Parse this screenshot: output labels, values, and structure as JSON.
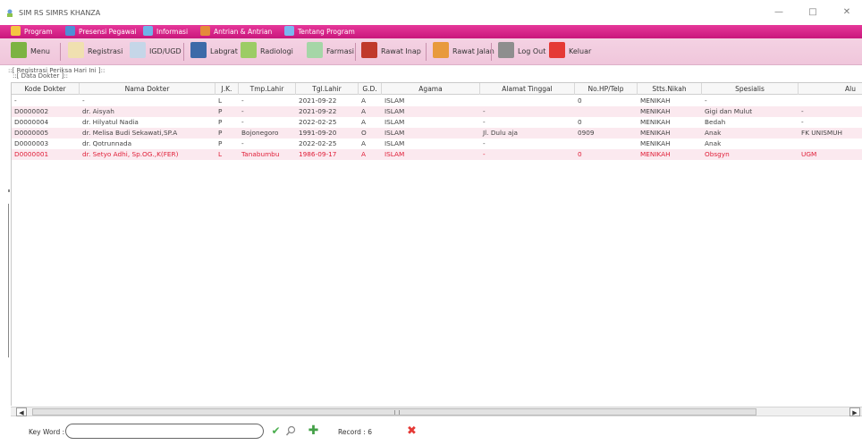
{
  "window": {
    "title": "SIM RS SIMRS KHANZA",
    "controls": {
      "minimize": "—",
      "maximize": "□",
      "close": "✕"
    }
  },
  "menubar": [
    {
      "label": "Program",
      "icon": "key-icon"
    },
    {
      "label": "Presensi Pegawai",
      "icon": "people-icon"
    },
    {
      "label": "Informasi",
      "icon": "info-icon"
    },
    {
      "label": "Antrian & Antrian",
      "icon": "queue-icon"
    },
    {
      "label": "Tentang Program",
      "icon": "about-icon"
    }
  ],
  "toolbar": [
    {
      "label": "Menu",
      "icon": "home-icon"
    },
    {
      "label": "Registrasi",
      "icon": "register-icon"
    },
    {
      "label": "IGD/UGD",
      "icon": "emergency-icon"
    },
    {
      "label": "Labgrat",
      "icon": "lab-icon"
    },
    {
      "label": "Radiologi",
      "icon": "radiology-icon"
    },
    {
      "label": "Farmasi",
      "icon": "pharmacy-icon"
    },
    {
      "label": "Rawat Inap",
      "icon": "inpatient-icon"
    },
    {
      "label": "Rawat Jalan",
      "icon": "outpatient-icon"
    },
    {
      "label": "Log Out",
      "icon": "logout-icon"
    },
    {
      "label": "Keluar",
      "icon": "exit-icon"
    }
  ],
  "panels": {
    "outer_title": "::[ Registrasi Periksa Hari Ini ]::",
    "inner_title": "::[ Data Dokter ]::"
  },
  "table": {
    "columns": [
      "Kode Dokter",
      "Nama Dokter",
      "J.K.",
      "Tmp.Lahir",
      "Tgl.Lahir",
      "G.D.",
      "Agama",
      "Alamat Tinggal",
      "No.HP/Telp",
      "Stts.Nikah",
      "Spesialis",
      "Alu"
    ],
    "rows": [
      [
        "-",
        "-",
        "L",
        "-",
        "2021-09-22",
        "A",
        "ISLAM",
        "",
        "0",
        "MENIKAH",
        "-",
        ""
      ],
      [
        "D0000002",
        "dr. Aisyah",
        "P",
        "-",
        "2021-09-22",
        "A",
        "ISLAM",
        "-",
        "",
        "MENIKAH",
        "Gigi dan Mulut",
        "-"
      ],
      [
        "D0000004",
        "dr. Hilyatul Nadia",
        "P",
        "-",
        "2022-02-25",
        "A",
        "ISLAM",
        "-",
        "0",
        "MENIKAH",
        "Bedah",
        "-"
      ],
      [
        "D0000005",
        "dr. Melisa Budi Sekawati,SP.A",
        "P",
        "Bojonegoro",
        "1991-09-20",
        "O",
        "ISLAM",
        "Jl. Dulu aja",
        "0909",
        "MENIKAH",
        "Anak",
        "FK UNISMUH"
      ],
      [
        "D0000003",
        "dr. Qotrunnada",
        "P",
        "-",
        "2022-02-25",
        "A",
        "ISLAM",
        "-",
        "",
        "MENIKAH",
        "Anak",
        ""
      ],
      [
        "D0000001",
        "dr. Setyo Adhi, Sp.OG.,K(FER)",
        "L",
        "Tanabumbu",
        "1986-09-17",
        "A",
        "ISLAM",
        "-",
        "0",
        "MENIKAH",
        "Obsgyn",
        "UGM"
      ]
    ],
    "selected_row": 5
  },
  "scrollbar": {
    "left": "◀",
    "right": "▶"
  },
  "bottom": {
    "keyword_label": "Key Word :",
    "keyword_value": "",
    "record_label": "Record : 6"
  },
  "colors": {
    "menubar": "#d52487",
    "toolbar": "#f2cce0",
    "selected_text": "#e0203a"
  }
}
